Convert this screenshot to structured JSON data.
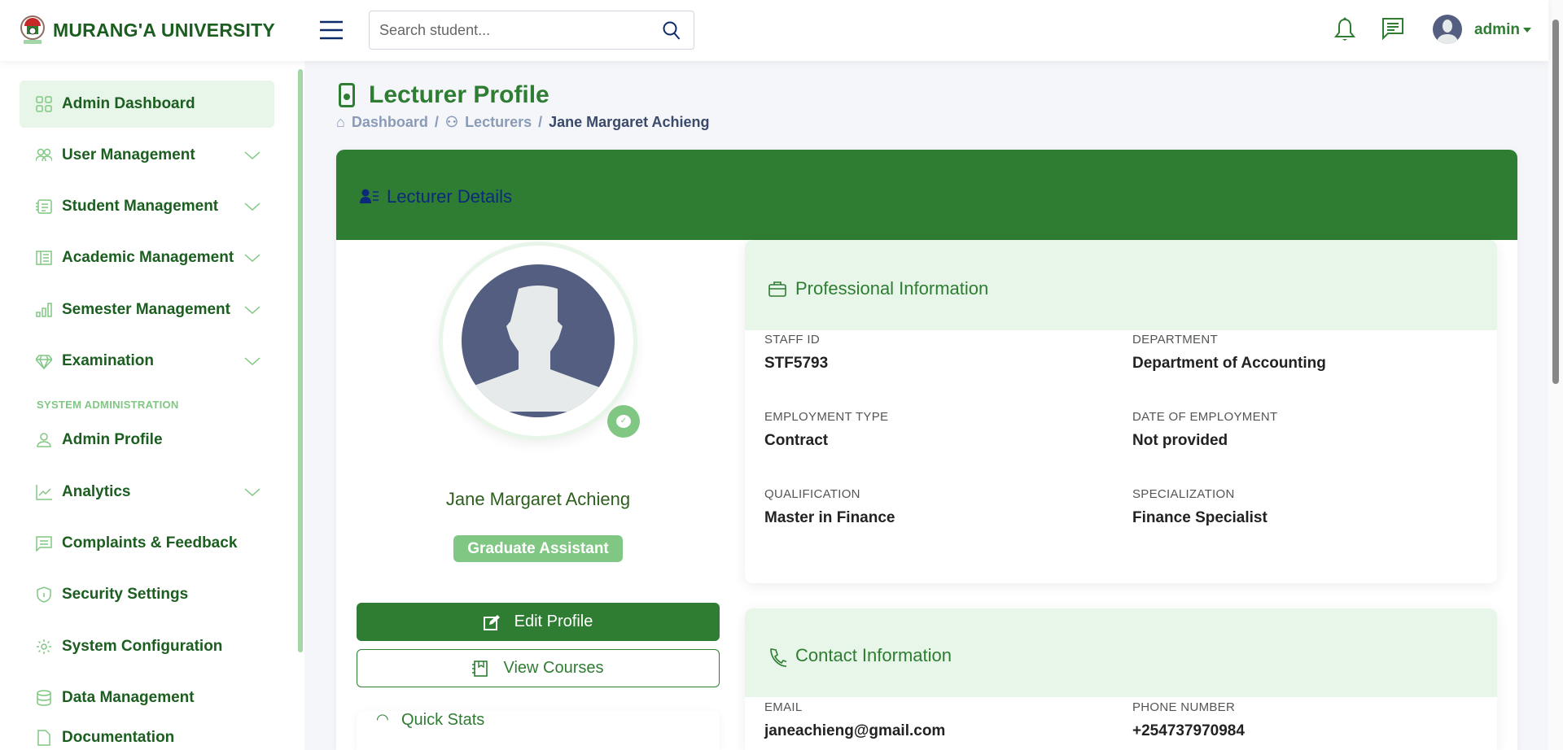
{
  "header": {
    "brand": "MURANG'A UNIVERSITY",
    "search_placeholder": "Search student...",
    "user": "admin"
  },
  "sidebar": {
    "items": [
      {
        "label": "Admin Dashboard",
        "icon": "grid-icon",
        "chevron": false
      },
      {
        "label": "User Management",
        "icon": "users-icon",
        "chevron": true
      },
      {
        "label": "Student Management",
        "icon": "list-icon",
        "chevron": true
      },
      {
        "label": "Academic Management",
        "icon": "table-icon",
        "chevron": true
      },
      {
        "label": "Semester Management",
        "icon": "bar-chart-icon",
        "chevron": true
      },
      {
        "label": "Examination",
        "icon": "gem-icon",
        "chevron": true
      }
    ],
    "section": "SYSTEM ADMINISTRATION",
    "admin_items": [
      {
        "label": "Admin Profile",
        "icon": "person-icon",
        "chevron": false
      },
      {
        "label": "Analytics",
        "icon": "line-chart-icon",
        "chevron": true
      },
      {
        "label": "Complaints & Feedback",
        "icon": "chat-icon",
        "chevron": false
      },
      {
        "label": "Security Settings",
        "icon": "shield-icon",
        "chevron": false
      },
      {
        "label": "System Configuration",
        "icon": "gear-icon",
        "chevron": false
      },
      {
        "label": "Data Management",
        "icon": "database-icon",
        "chevron": false
      },
      {
        "label": "Documentation",
        "icon": "file-icon",
        "chevron": false
      }
    ]
  },
  "page": {
    "title": "Lecturer Profile",
    "breadcrumb": [
      "Dashboard",
      "Lecturers",
      "Jane Margaret Achieng"
    ]
  },
  "card": {
    "title": "Lecturer Details"
  },
  "profile": {
    "name": "Jane Margaret Achieng",
    "role": "Graduate Assistant",
    "edit_label": "Edit Profile",
    "courses_label": "View Courses",
    "quick_stats": "Quick Stats"
  },
  "professional": {
    "title": "Professional Information",
    "fields": [
      {
        "label": "STAFF ID",
        "value": "STF5793"
      },
      {
        "label": "DEPARTMENT",
        "value": "Department of Accounting"
      },
      {
        "label": "EMPLOYMENT TYPE",
        "value": "Contract"
      },
      {
        "label": "DATE OF EMPLOYMENT",
        "value": "Not provided"
      },
      {
        "label": "QUALIFICATION",
        "value": "Master in Finance"
      },
      {
        "label": "SPECIALIZATION",
        "value": "Finance Specialist"
      }
    ]
  },
  "contact": {
    "title": "Contact Information",
    "fields": [
      {
        "label": "EMAIL",
        "value": "janeachieng@gmail.com"
      },
      {
        "label": "PHONE NUMBER",
        "value": "+254737970984"
      }
    ]
  },
  "colors": {
    "primary": "#2e7d32",
    "light": "#e8f5e9",
    "badge": "#81c784"
  }
}
